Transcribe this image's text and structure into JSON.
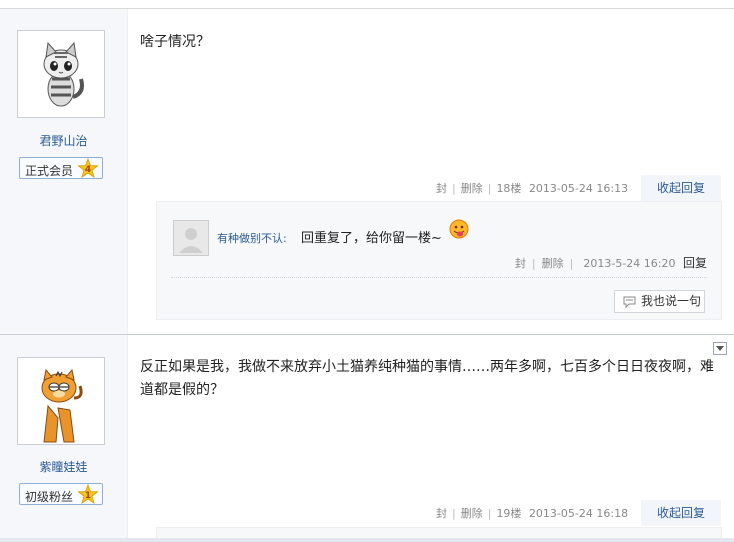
{
  "posts": [
    {
      "username": "君野山治",
      "rank_label": "正式会员",
      "rank_level": "4",
      "content": "啥子情况？",
      "actions": {
        "seal": "封",
        "delete": "删除"
      },
      "floor": "18楼",
      "timestamp": "2013-05-24 16:13",
      "fold_label": "收起回复",
      "replies": [
        {
          "username": "有种做别不认:",
          "text": "回重复了，给你留一楼~",
          "seal": "封",
          "delete": "删除",
          "timestamp": "2013-5-24 16:20",
          "reply_label": "回复"
        }
      ],
      "say_button": "我也说一句"
    },
    {
      "username": "紫瞳娃娃",
      "rank_label": "初级粉丝",
      "rank_level": "1",
      "content": "反正如果是我，我做不来放弃小土猫养纯种猫的事情……两年多啊，七百多个日日夜夜啊，难道都是假的？",
      "actions": {
        "seal": "封",
        "delete": "删除"
      },
      "floor": "19楼",
      "timestamp": "2013-05-24 16:18",
      "fold_label": "收起回复"
    }
  ],
  "colors": {
    "link": "#2b5b94",
    "sidebar_bg": "#f5f7fa",
    "star": "#f5c518"
  }
}
